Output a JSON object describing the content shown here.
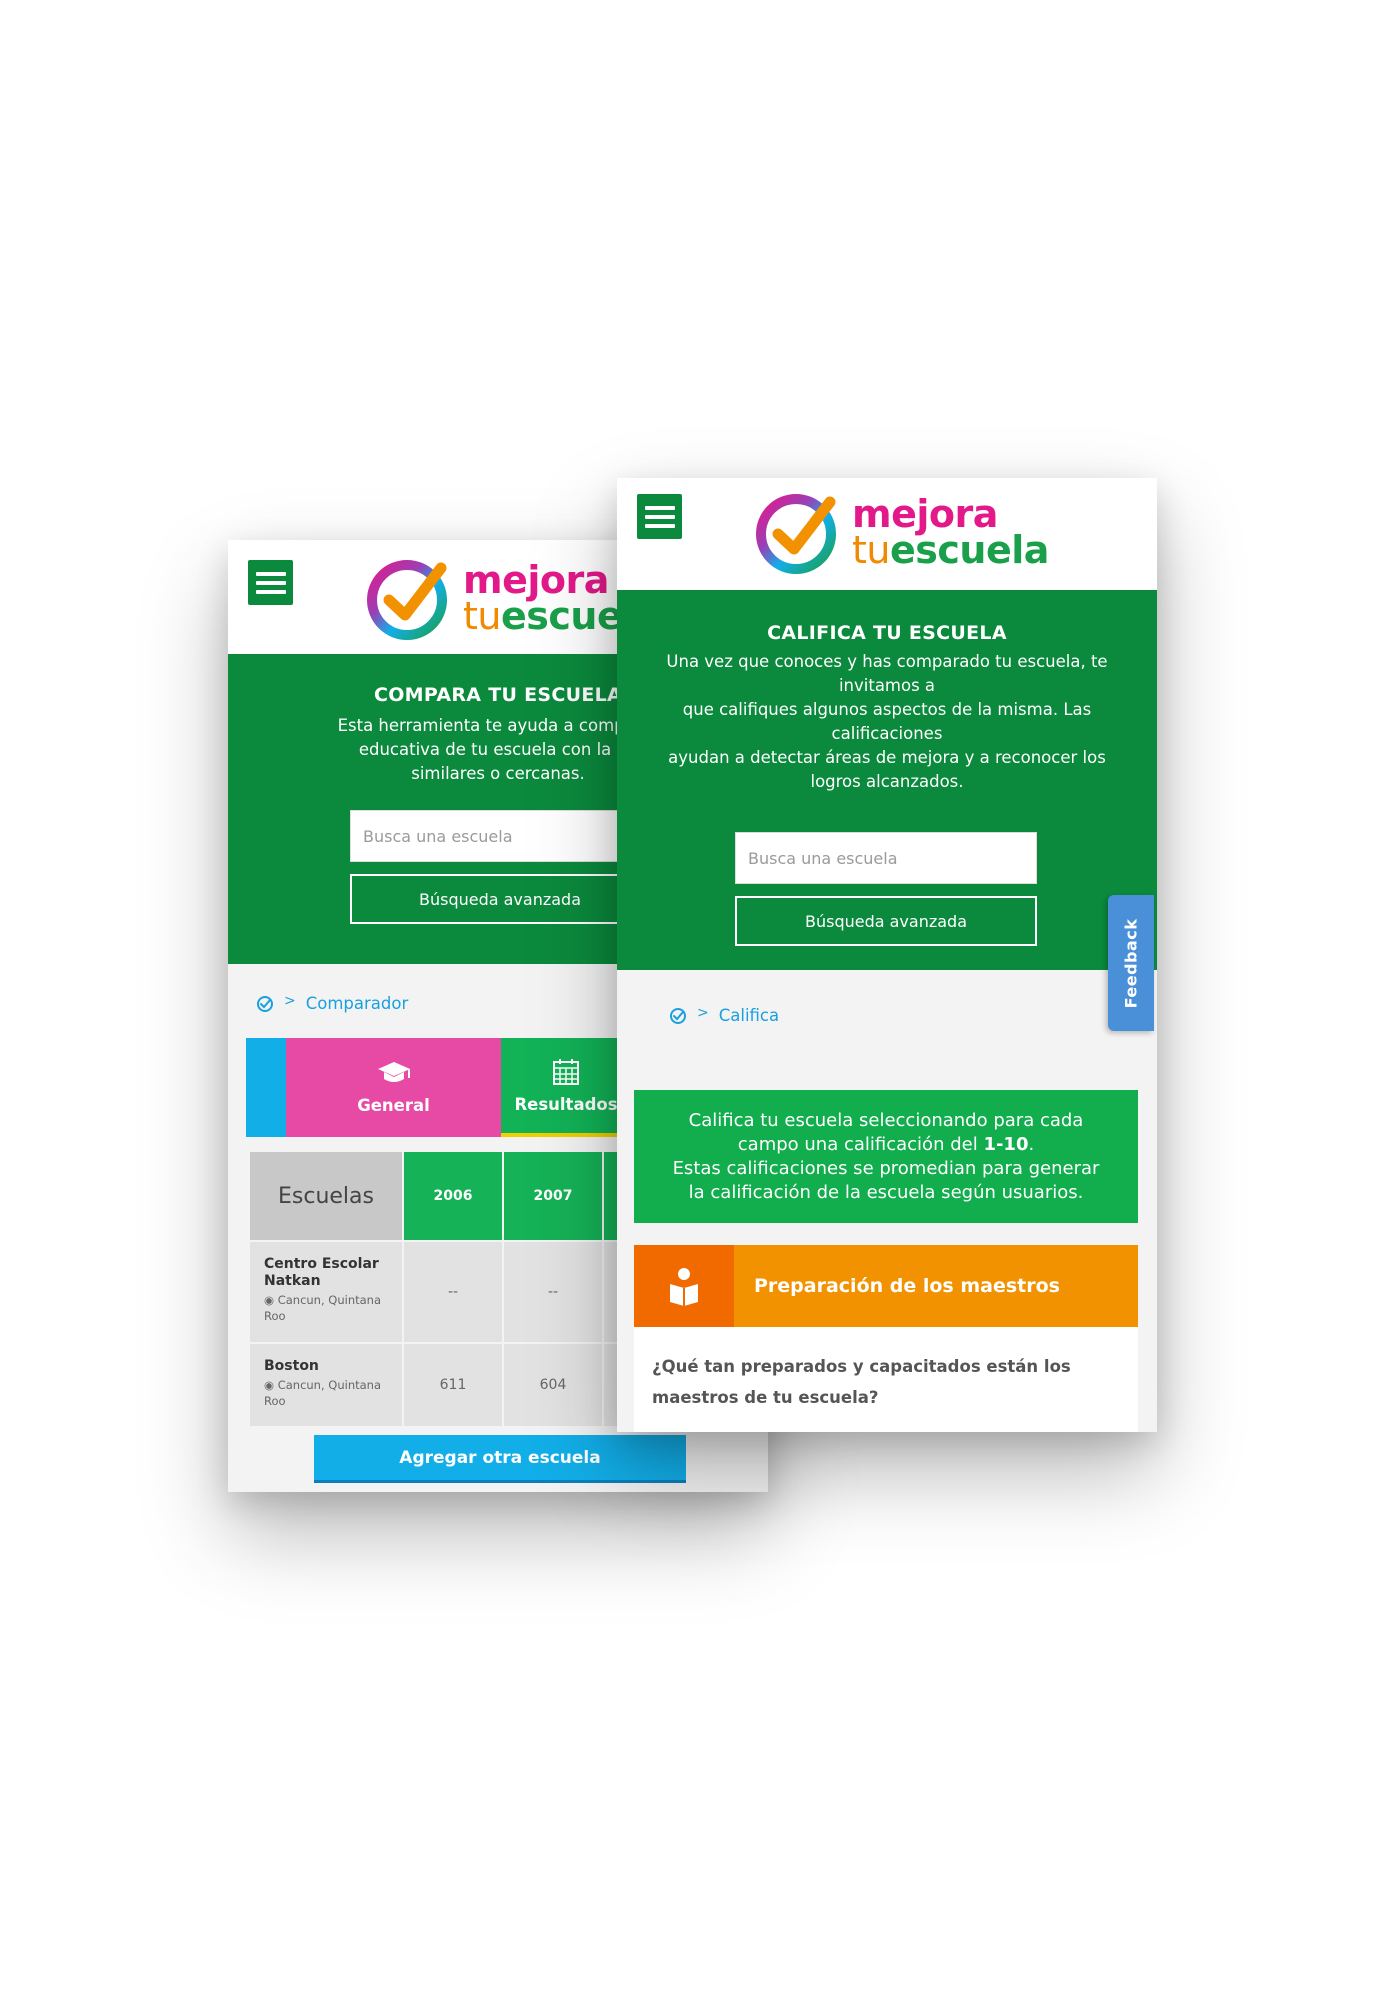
{
  "brand": {
    "name_line1": "mejora",
    "name_tu": "tu",
    "name_escuela": "escuela",
    "colors": {
      "green": "#0b8a3d",
      "pink": "#e3198a",
      "orange": "#f08a00",
      "blue": "#12aee8"
    }
  },
  "compare_screen": {
    "hero_title": "COMPARA TU ESCUELA",
    "hero_text_1": "Esta herramienta te ayuda a comparar",
    "hero_text_2": "educativa de tu escuela con la de",
    "hero_text_3": "similares o cercanas.",
    "search_placeholder": "Busca una escuela",
    "advanced_search": "Búsqueda avanzada",
    "breadcrumb": "Comparador",
    "tabs": [
      {
        "label": "General",
        "icon": "graduation-cap-icon"
      },
      {
        "label": "Resultados",
        "icon": "calendar-icon"
      }
    ],
    "table": {
      "header_label": "Escuelas",
      "years": [
        "2006",
        "2007"
      ],
      "rows": [
        {
          "name": "Centro Escolar Natkan",
          "location": "Cancun, Quintana Roo",
          "values": [
            "--",
            "--"
          ]
        },
        {
          "name": "Boston",
          "location": "Cancun, Quintana Roo",
          "values": [
            "611",
            "604"
          ]
        }
      ]
    },
    "add_button": "Agregar otra escuela"
  },
  "rate_screen": {
    "hero_title": "CALIFICA TU ESCUELA",
    "hero_lines": [
      "Una vez que conoces y has comparado tu escuela, te",
      "invitamos a",
      "que califiques algunos aspectos de la misma. Las",
      "calificaciones",
      "ayudan a detectar áreas de mejora y a reconocer los",
      "logros alcanzados."
    ],
    "search_placeholder": "Busca una escuela",
    "advanced_search": "Búsqueda avanzada",
    "breadcrumb": "Califica",
    "info_pre": "Califica tu escuela seleccionando para cada",
    "info_mid": "campo una calificación del ",
    "info_bold": "1-10",
    "info_dot": ".",
    "info_line3": "Estas calificaciones se promedian para generar",
    "info_line4": "la calificación de la escuela según usuarios.",
    "section_title": "Preparación de los maestros",
    "question_1": "¿Qué tan preparados y capacitados están los",
    "question_2": "maestros de tu escuela?"
  },
  "feedback_label": "Feedback"
}
